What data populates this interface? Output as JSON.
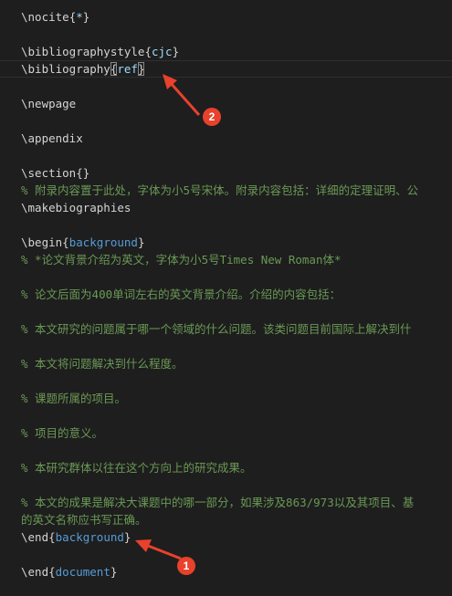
{
  "editor": {
    "lines": [
      {
        "segments": [
          {
            "t": "\\nocite",
            "c": "cmd"
          },
          {
            "t": "{",
            "c": "brace"
          },
          {
            "t": "*",
            "c": "arg"
          },
          {
            "t": "}",
            "c": "brace"
          }
        ]
      },
      {
        "segments": []
      },
      {
        "segments": [
          {
            "t": "\\bibliographystyle",
            "c": "cmd"
          },
          {
            "t": "{",
            "c": "brace"
          },
          {
            "t": "cjc",
            "c": "arg"
          },
          {
            "t": "}",
            "c": "brace"
          }
        ]
      },
      {
        "segments": [
          {
            "t": "\\bibliography",
            "c": "cmd"
          },
          {
            "t": "{",
            "c": "brace bm"
          },
          {
            "t": "ref",
            "c": "arg"
          },
          {
            "t": "}",
            "c": "brace bm"
          }
        ],
        "current": true
      },
      {
        "segments": []
      },
      {
        "segments": [
          {
            "t": "\\newpage",
            "c": "cmd"
          }
        ]
      },
      {
        "segments": []
      },
      {
        "segments": [
          {
            "t": "\\appendix",
            "c": "cmd"
          }
        ]
      },
      {
        "segments": []
      },
      {
        "segments": [
          {
            "t": "\\section",
            "c": "cmd"
          },
          {
            "t": "{}",
            "c": "brace"
          }
        ]
      },
      {
        "segments": [
          {
            "t": "% 附录内容置于此处，字体为小5号宋体。附录内容包括：详细的定理证明、公",
            "c": "comment"
          }
        ]
      },
      {
        "segments": [
          {
            "t": "\\makebiographies",
            "c": "cmd"
          }
        ]
      },
      {
        "segments": []
      },
      {
        "segments": [
          {
            "t": "\\begin",
            "c": "cmd"
          },
          {
            "t": "{",
            "c": "brace"
          },
          {
            "t": "background",
            "c": "envname"
          },
          {
            "t": "}",
            "c": "brace"
          }
        ]
      },
      {
        "segments": [
          {
            "t": "% *论文背景介绍为英文，字体为小5号Times New Roman体*",
            "c": "comment"
          }
        ]
      },
      {
        "segments": []
      },
      {
        "segments": [
          {
            "t": "% 论文后面为400单词左右的英文背景介绍。介绍的内容包括：",
            "c": "comment"
          }
        ]
      },
      {
        "segments": []
      },
      {
        "segments": [
          {
            "t": "% 本文研究的问题属于哪一个领域的什么问题。该类问题目前国际上解决到什",
            "c": "comment"
          }
        ]
      },
      {
        "segments": []
      },
      {
        "segments": [
          {
            "t": "% 本文将问题解决到什么程度。",
            "c": "comment"
          }
        ]
      },
      {
        "segments": []
      },
      {
        "segments": [
          {
            "t": "% 课题所属的项目。",
            "c": "comment"
          }
        ]
      },
      {
        "segments": []
      },
      {
        "segments": [
          {
            "t": "% 项目的意义。",
            "c": "comment"
          }
        ]
      },
      {
        "segments": []
      },
      {
        "segments": [
          {
            "t": "% 本研究群体以往在这个方向上的研究成果。",
            "c": "comment"
          }
        ]
      },
      {
        "segments": []
      },
      {
        "segments": [
          {
            "t": "% 本文的成果是解决大课题中的哪一部分，如果涉及863/973以及其项目、基",
            "c": "comment"
          }
        ]
      },
      {
        "segments": [
          {
            "t": "的英文名称应书写正确。",
            "c": "comment"
          }
        ]
      },
      {
        "segments": [
          {
            "t": "\\end",
            "c": "cmd"
          },
          {
            "t": "{",
            "c": "brace"
          },
          {
            "t": "background",
            "c": "envname"
          },
          {
            "t": "}",
            "c": "brace"
          }
        ]
      },
      {
        "segments": []
      },
      {
        "segments": [
          {
            "t": "\\end",
            "c": "cmd"
          },
          {
            "t": "{",
            "c": "brace"
          },
          {
            "t": "document",
            "c": "envname"
          },
          {
            "t": "}",
            "c": "brace"
          }
        ]
      }
    ]
  },
  "annotations": {
    "badge1": "1",
    "badge2": "2",
    "color": "#e8412c"
  },
  "colors": {
    "background": "#1e1e1e",
    "text": "#d4d4d4",
    "comment": "#6a9955",
    "argument": "#9cdcfe",
    "environment": "#569cd6"
  }
}
